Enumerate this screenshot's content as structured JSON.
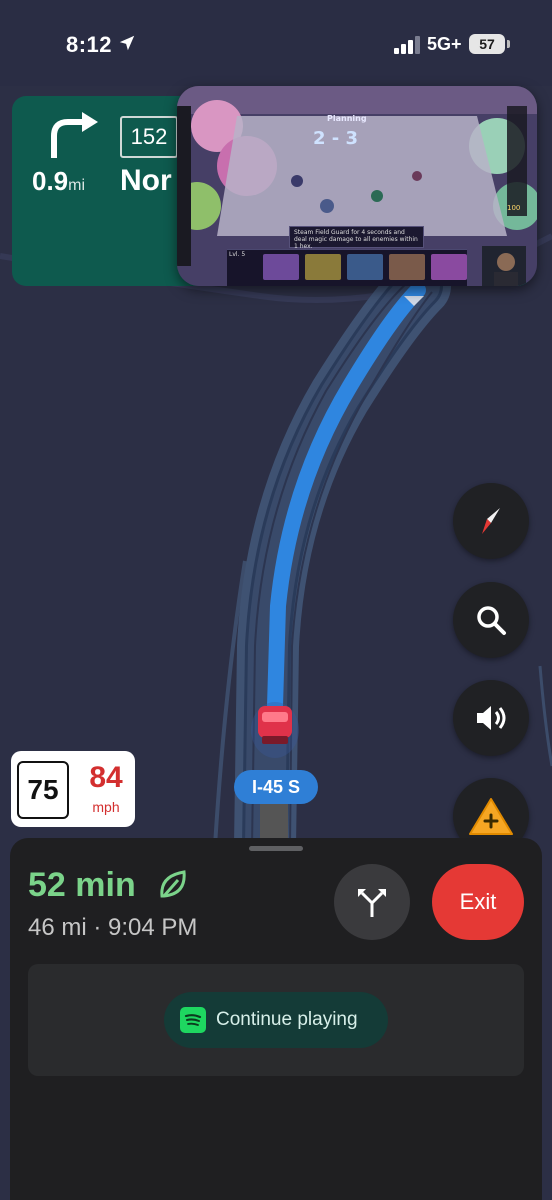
{
  "status_bar": {
    "time": "8:12",
    "network": "5G+",
    "battery": "57",
    "icons": [
      "location-arrow-icon",
      "signal-bars-icon"
    ]
  },
  "navigation": {
    "turn_direction": "turn-right-icon",
    "distance_value": "0.9",
    "distance_unit": "mi",
    "route_number": "152",
    "street_fragment": "Nor"
  },
  "pip_video": {
    "title": "Planning",
    "score": "2 - 3",
    "ability_text": "Steam Field Guard for 4 seconds and deal magic damage to all enemies within 1 hex.",
    "level_text": "Lvl. 5",
    "gold": "100"
  },
  "map_controls": {
    "compass": "compass-icon",
    "search": "search-icon",
    "sound": "volume-icon",
    "report": "report-incident-icon"
  },
  "road": {
    "label": "I-45 S"
  },
  "speed": {
    "limit": "75",
    "current": "84",
    "unit": "mph"
  },
  "trip": {
    "eta_minutes": "52 min",
    "summary": "46 mi · 9:04 PM",
    "exit_label": "Exit",
    "alt_routes_icon": "alternate-routes-icon"
  },
  "media": {
    "continue_label": "Continue playing",
    "app_icon": "spotify-icon"
  },
  "colors": {
    "nav_card": "#0e5a4e",
    "route_blue": "#2f86e0",
    "eta_green": "#7bd38a",
    "exit_red": "#e53935",
    "speed_red": "#d32f2f"
  }
}
